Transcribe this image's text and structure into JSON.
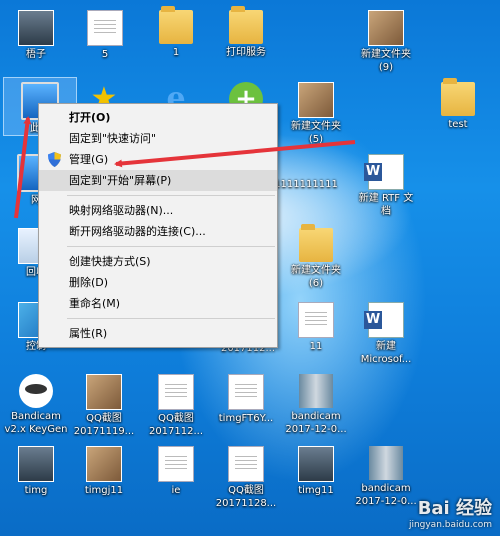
{
  "desktop": {
    "icons": [
      {
        "id": "meizi",
        "label": "梧子",
        "type": "person"
      },
      {
        "id": "five",
        "label": "5",
        "type": "doc"
      },
      {
        "id": "one",
        "label": "1",
        "type": "folder"
      },
      {
        "id": "print",
        "label": "打印服务",
        "type": "folder"
      },
      {
        "id": "newfolder9",
        "label": "新建文件夹\n(9)",
        "type": "photo"
      },
      {
        "id": "thispc",
        "label": "此电",
        "type": "computer"
      },
      {
        "id": "star",
        "label": "",
        "type": "star"
      },
      {
        "id": "ie1",
        "label": "",
        "type": "ie"
      },
      {
        "id": "plus",
        "label": "",
        "type": "plus"
      },
      {
        "id": "newfolder5",
        "label": "新建文件夹\n(5)",
        "type": "photo"
      },
      {
        "id": "test",
        "label": "test",
        "type": "folder"
      },
      {
        "id": "net",
        "label": "网",
        "type": "computer"
      },
      {
        "id": "digits",
        "label": "1111111111",
        "type": "none"
      },
      {
        "id": "rtf",
        "label": "新建 RTF 文\n档",
        "type": "word"
      },
      {
        "id": "recycle",
        "label": "回收",
        "type": "recycle"
      },
      {
        "id": "newfolder6",
        "label": "新建文件夹\n(6)",
        "type": "folder"
      },
      {
        "id": "control",
        "label": "控制",
        "type": "panel"
      },
      {
        "id": "eleven",
        "label": "11",
        "type": "doc"
      },
      {
        "id": "msword",
        "label": "新建\nMicrosof...",
        "type": "word"
      },
      {
        "id": "date1",
        "label": "2017112...",
        "type": "none"
      },
      {
        "id": "bandicam1",
        "label": "Bandicam\nv2.x KeyGen",
        "type": "bandicam"
      },
      {
        "id": "qq1",
        "label": "QQ截图\n20171119...",
        "type": "photo"
      },
      {
        "id": "qq2",
        "label": "QQ截图\n2017112...",
        "type": "doc"
      },
      {
        "id": "timgf6",
        "label": "timgFT6Y...",
        "type": "doc"
      },
      {
        "id": "bandicam2",
        "label": "bandicam\n2017-12-0...",
        "type": "strip"
      },
      {
        "id": "timg",
        "label": "timg",
        "type": "person"
      },
      {
        "id": "timgj11",
        "label": "timgj11",
        "type": "photo"
      },
      {
        "id": "ie2",
        "label": "ie",
        "type": "doc"
      },
      {
        "id": "qq3",
        "label": "QQ截图\n20171128...",
        "type": "doc"
      },
      {
        "id": "timg11",
        "label": "timg11",
        "type": "person"
      },
      {
        "id": "bandicam3",
        "label": "bandicam\n2017-12-0...",
        "type": "strip"
      }
    ]
  },
  "context_menu": {
    "items": [
      {
        "label": "打开(O)",
        "kind": "item",
        "bold": true
      },
      {
        "label": "固定到\"快速访问\"",
        "kind": "item"
      },
      {
        "label": "管理(G)",
        "kind": "item",
        "shield": true
      },
      {
        "label": "固定到\"开始\"屏幕(P)",
        "kind": "item",
        "hover": true
      },
      {
        "kind": "sep"
      },
      {
        "label": "映射网络驱动器(N)...",
        "kind": "item"
      },
      {
        "label": "断开网络驱动器的连接(C)...",
        "kind": "item"
      },
      {
        "kind": "sep"
      },
      {
        "label": "创建快捷方式(S)",
        "kind": "item"
      },
      {
        "label": "删除(D)",
        "kind": "item"
      },
      {
        "label": "重命名(M)",
        "kind": "item"
      },
      {
        "kind": "sep"
      },
      {
        "label": "属性(R)",
        "kind": "item"
      }
    ]
  },
  "annotation_color": "#e5343a",
  "watermark": {
    "logo": "Bai 经验",
    "url": "jingyan.baidu.com"
  }
}
